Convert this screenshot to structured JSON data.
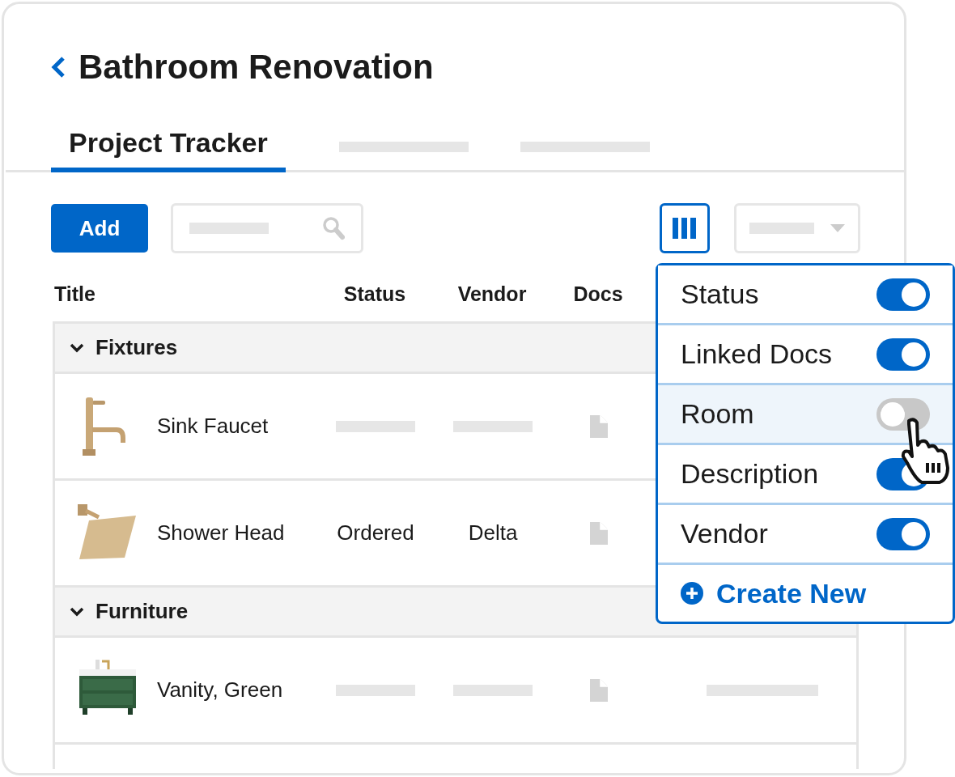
{
  "header": {
    "title": "Bathroom Renovation"
  },
  "tabs": [
    {
      "kind": "text",
      "label": "Project Tracker",
      "selected": true
    },
    {
      "kind": "skeleton",
      "selected": false
    },
    {
      "kind": "skeleton",
      "selected": false
    }
  ],
  "toolbar": {
    "add_button": "Add",
    "columns_button": {
      "selected": true
    }
  },
  "table": {
    "columns": [
      "Title",
      "Status",
      "Vendor",
      "Docs"
    ],
    "groups": [
      {
        "name": "Fixtures",
        "expanded": true,
        "rows": [
          {
            "title": "Sink Faucet",
            "kind": "faucet",
            "cells": [
              {
                "kind": "skeleton"
              },
              {
                "kind": "skeleton"
              },
              {
                "kind": "document"
              }
            ]
          },
          {
            "title": "Shower Head",
            "kind": "shower-head",
            "cells": [
              {
                "kind": "text",
                "text": "Ordered"
              },
              {
                "kind": "text",
                "text": "Delta"
              },
              {
                "kind": "document"
              }
            ]
          }
        ]
      },
      {
        "name": "Furniture",
        "expanded": true,
        "rows": [
          {
            "title": "Vanity, Green",
            "kind": "vanity",
            "cells": [
              {
                "kind": "skeleton"
              },
              {
                "kind": "skeleton"
              },
              {
                "kind": "document"
              },
              {
                "kind": "skeleton"
              }
            ]
          }
        ]
      }
    ]
  },
  "column_menu": {
    "items": [
      {
        "label": "Status",
        "on": true,
        "hovered": false
      },
      {
        "label": "Linked Docs",
        "on": true,
        "hovered": false
      },
      {
        "label": "Room",
        "on": false,
        "hovered": true
      },
      {
        "label": "Description",
        "on": true,
        "hovered": false
      },
      {
        "label": "Vendor",
        "on": true,
        "hovered": false
      }
    ],
    "create_new": "Create New"
  }
}
